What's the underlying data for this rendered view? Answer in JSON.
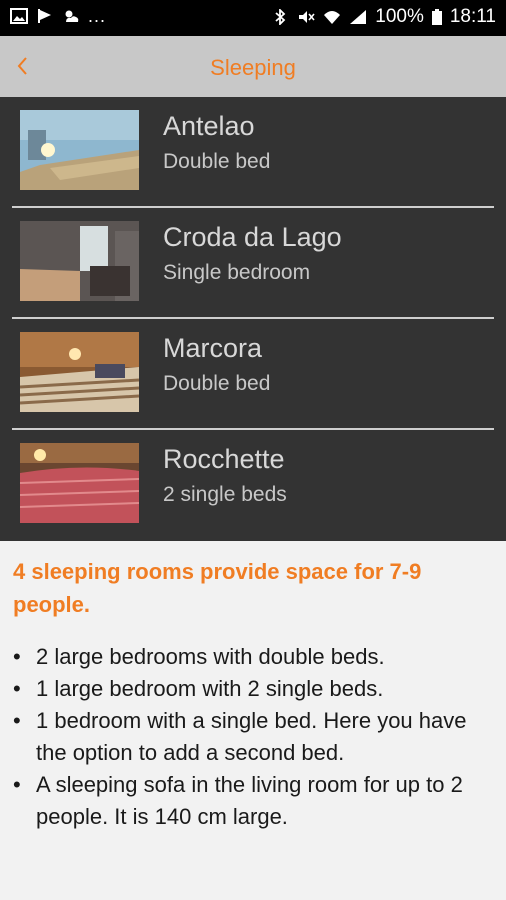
{
  "status_bar": {
    "battery": "100%",
    "time": "18:11",
    "left_icons": [
      "gallery-icon",
      "flag-icon",
      "weather-icon"
    ],
    "more": "...",
    "right_icons": [
      "bluetooth-icon",
      "mute-icon",
      "wifi-icon",
      "signal-icon",
      "battery-icon"
    ]
  },
  "app_bar": {
    "title": "Sleeping",
    "back_icon": "chevron-left-icon",
    "accent_color": "#f07d23"
  },
  "rooms": [
    {
      "name": "Antelao",
      "description": "Double bed"
    },
    {
      "name": "Croda da Lago",
      "description": "Single bedroom"
    },
    {
      "name": "Marcora",
      "description": "Double bed"
    },
    {
      "name": "Rocchette",
      "description": "2 single beds"
    }
  ],
  "content": {
    "lead": "4 sleeping rooms provide space for 7-9 people.",
    "bullets": [
      "2 large bedrooms with double beds.",
      "1 large bedroom with 2 single beds.",
      "1 bedroom with a single bed. Here you have the option to add a second bed.",
      "A sleeping sofa in the living room for up to 2 people. It is 140 cm large."
    ]
  }
}
